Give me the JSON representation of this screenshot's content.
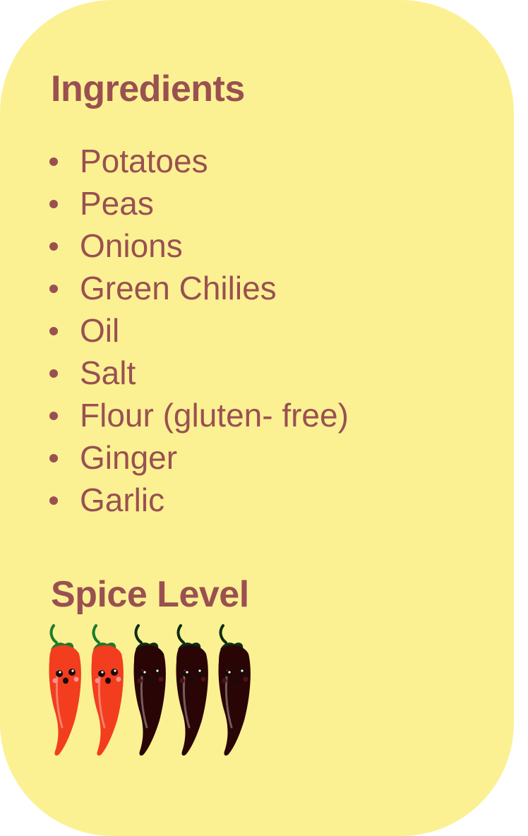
{
  "ingredients": {
    "title": "Ingredients",
    "items": [
      {
        "label": "Potatoes"
      },
      {
        "label": "Peas"
      },
      {
        "label": "Onions"
      },
      {
        "label": "Green Chilies"
      },
      {
        "label": "Oil"
      },
      {
        "label": "Salt"
      },
      {
        "label": "Flour (gluten- free)"
      },
      {
        "label": "Ginger"
      },
      {
        "label": "Garlic"
      }
    ]
  },
  "spice": {
    "title": "Spice Level",
    "level": 2,
    "max": 5,
    "icon": "chili-pepper-icon"
  },
  "colors": {
    "card_background": "#fbf193",
    "text": "#9a5051",
    "chili_active": "#f23d1e",
    "chili_inactive": "#2a0506",
    "stem_active": "#1e7a2b",
    "stem_inactive": "#0d2d12"
  }
}
